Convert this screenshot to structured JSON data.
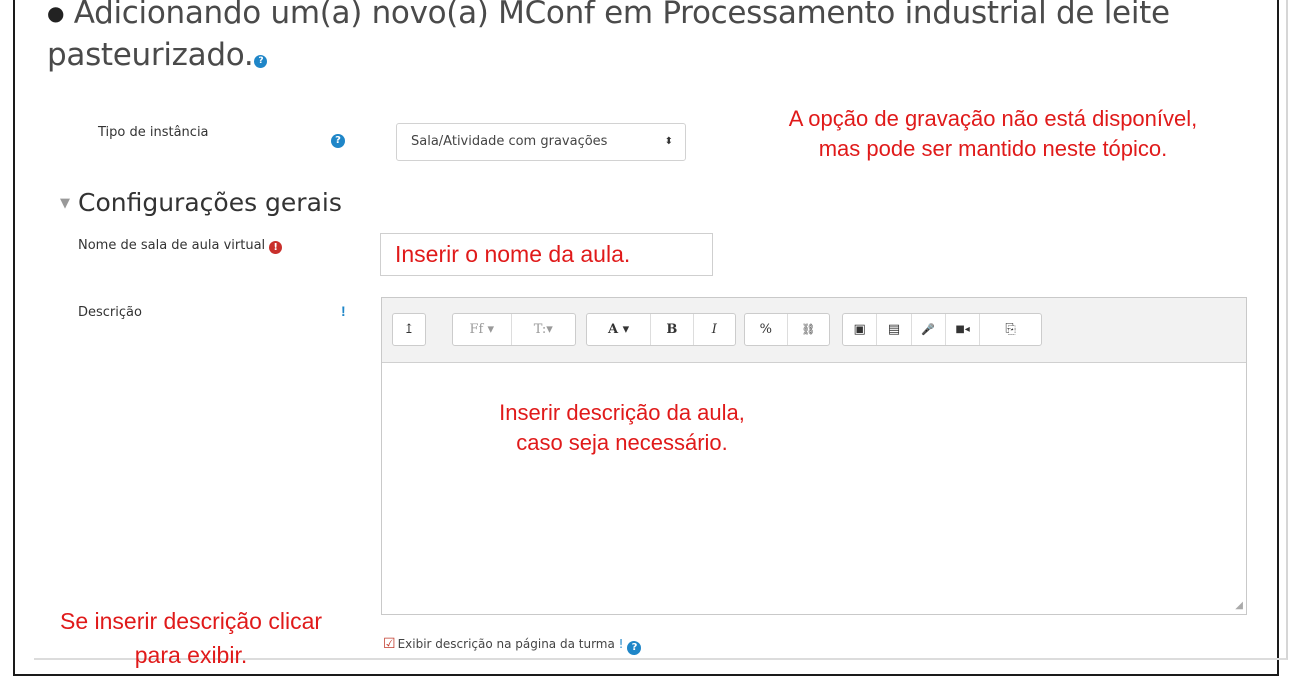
{
  "heading": {
    "text": "Adicionando um(a) novo(a) MConf em Processamento industrial de leite pasteurizado.",
    "bullet_icon": "circle-bullet-icon",
    "help_icon": "question-circle-icon"
  },
  "instance_type": {
    "label": "Tipo de instância",
    "selected": "Sala/Atividade com gravações",
    "help_icon": "question-circle-icon"
  },
  "annotations": {
    "recording": "A opção de gravação não está disponível,\nmas pode ser mantido neste tópico.",
    "name": "Inserir o nome da aula.",
    "description": "Inserir descrição da aula,\ncaso seja necessário.",
    "show_description": "Se inserir descrição clicar\npara exibir."
  },
  "section": {
    "title": "Configurações gerais"
  },
  "name_field": {
    "label": "Nome de sala de aula virtual",
    "required_icon": "exclamation-circle-icon"
  },
  "description_field": {
    "label": "Descrição",
    "marker": "!"
  },
  "toolbar": {
    "toggle": "↥",
    "font_family": "Ff ▾",
    "paragraph": "T:▾",
    "font_color": "A ▾",
    "bold": "B",
    "italic": "I",
    "link": "%",
    "unlink": "⛓",
    "image": "▣",
    "media": "▤",
    "audio": "🎤",
    "video": "■◂",
    "manage_files": "⎘"
  },
  "show_description": {
    "label": "Exibir descrição na página da turma",
    "marker": "!",
    "checked": true
  },
  "colors": {
    "annotation_red": "#e01a1a",
    "help_blue": "#1f86c8",
    "required_red": "#c9302c"
  }
}
